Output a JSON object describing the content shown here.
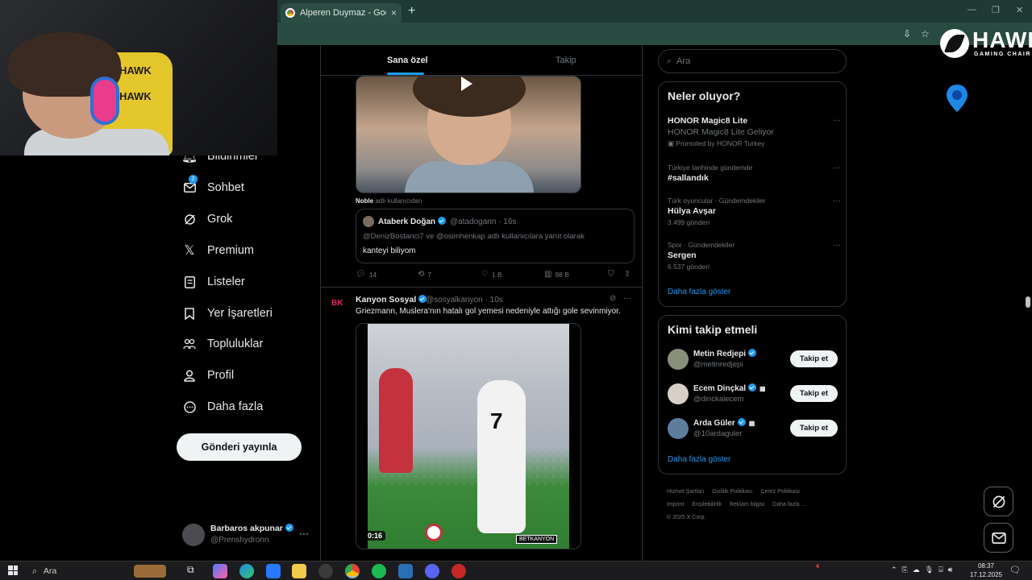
{
  "browser": {
    "tab_title": "Alperen Duymaz - Google'da A",
    "new_tab": "+",
    "close": "×"
  },
  "webcam": {
    "chair_brand_top": "HAWK",
    "chair_brand_bottom": "HAWK"
  },
  "overlay_logo": {
    "word": "HAWK",
    "sub": "GAMING CHAIR"
  },
  "nav": {
    "items": [
      {
        "label": "Bildirimler",
        "icon": "bell-icon"
      },
      {
        "label": "Sohbet",
        "icon": "mail-icon",
        "badge": "2"
      },
      {
        "label": "Grok",
        "icon": "grok-icon"
      },
      {
        "label": "Premium",
        "icon": "x-logo-icon"
      },
      {
        "label": "Listeler",
        "icon": "list-icon"
      },
      {
        "label": "Yer İşaretleri",
        "icon": "bookmark-icon"
      },
      {
        "label": "Topluluklar",
        "icon": "communities-icon"
      },
      {
        "label": "Profil",
        "icon": "profile-icon"
      },
      {
        "label": "Daha fazla",
        "icon": "more-circle-icon"
      }
    ],
    "post_button": "Gönderi yayınla"
  },
  "account": {
    "name": "Barbaros akpunar",
    "handle": "@Prenshydronn",
    "menu": "···"
  },
  "feed": {
    "tabs": [
      "Sana özel",
      "Takip"
    ],
    "tweet1": {
      "reply_context_user": "Noble",
      "reply_context_rest": " adlı kullanıcıdan",
      "quote": {
        "name": "Ataberk Doğan",
        "handle": "@atadogann · 16s",
        "reply_to": "@DenizBostanci7 ve @osimhenkap adlı kullanıcılara yanıt olarak",
        "text": "kanteyi biliyom"
      },
      "stats": {
        "replies": "14",
        "reposts": "7",
        "likes": "1 B",
        "views": "98 B"
      }
    },
    "tweet2": {
      "avatar_text": "BK",
      "name": "Kanyon Sosyal",
      "handle": "@sosyalkanyon · 10s",
      "text": "Griezmann, Muslera'nın hatalı gol yemesi nedeniyle attığı gole sevinmiyor.",
      "video_duration": "0:16",
      "watermark": "BETKANYON",
      "shirt_number": "7"
    }
  },
  "sidebar": {
    "search_placeholder": "Ara",
    "trends_title": "Neler oluyor?",
    "trends": [
      {
        "context": "",
        "title": "HONOR Magic8 Lite",
        "subtitle": "HONOR Magic8 Lite Geliyor",
        "meta": "Promoted by HONOR Turkey"
      },
      {
        "context": "Türkiye tarihinde gündemde",
        "title": "#sallandık",
        "subtitle": "",
        "meta": ""
      },
      {
        "context": "Türk oyuncular · Gündemdekiler",
        "title": "Hülya Avşar",
        "subtitle": "",
        "meta": "3.499 gönderi"
      },
      {
        "context": "Spor · Gündemdekiler",
        "title": "Sergen",
        "subtitle": "",
        "meta": "6.537 gönderi"
      }
    ],
    "show_more": "Daha fazla göster",
    "wtf_title": "Kimi takip etmeli",
    "who_to_follow": [
      {
        "name": "Metin Redjepi",
        "handle": "@metinredjepi",
        "button": "Takip et",
        "avatar_color": "#8a8f7a"
      },
      {
        "name": "Ecem Dinçkal",
        "handle": "@dinckalecem",
        "button": "Takip et",
        "avatar_color": "#d8d0c8"
      },
      {
        "name": "Arda Güler",
        "handle": "@10ardaguler",
        "button": "Takip et",
        "avatar_color": "#5c7d9c"
      }
    ],
    "wtf_show_more": "Daha fazla göster",
    "footer": [
      "Hizmet Şartları",
      "Gizlilik Politikası",
      "Çerez Politikası",
      "Imprint",
      "Erişilebilirlik",
      "Reklam bilgisi",
      "Daha fazla ...",
      "© 2025 X Corp."
    ]
  },
  "taskbar": {
    "search": "Ara",
    "notification_count": "4",
    "time": "08:37",
    "date": "17.12.2025"
  },
  "colors": {
    "accent": "#1d9bf0",
    "browser_frame": "#1e3a33",
    "border": "#2f3336"
  }
}
